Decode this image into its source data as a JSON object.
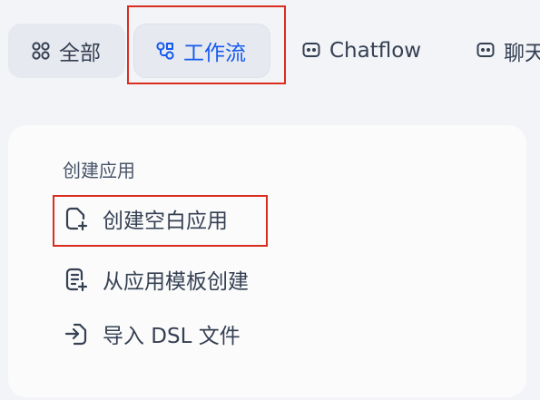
{
  "tabs": [
    {
      "label": "全部",
      "icon": "grid-icon"
    },
    {
      "label": "工作流",
      "icon": "workflow-icon",
      "active": true
    },
    {
      "label": "Chatflow",
      "icon": "chat-bubble-icon"
    },
    {
      "label": "聊天",
      "icon": "chat-bubble-icon"
    }
  ],
  "create_panel": {
    "title": "创建应用",
    "items": [
      {
        "label": "创建空白应用",
        "icon": "file-plus-icon"
      },
      {
        "label": "从应用模板创建",
        "icon": "template-plus-icon"
      },
      {
        "label": "导入 DSL 文件",
        "icon": "import-icon"
      }
    ]
  },
  "colors": {
    "active_tab_text": "#155aef",
    "text": "#354052",
    "highlight_box": "#d92d20",
    "background": "#f2f4f7"
  }
}
